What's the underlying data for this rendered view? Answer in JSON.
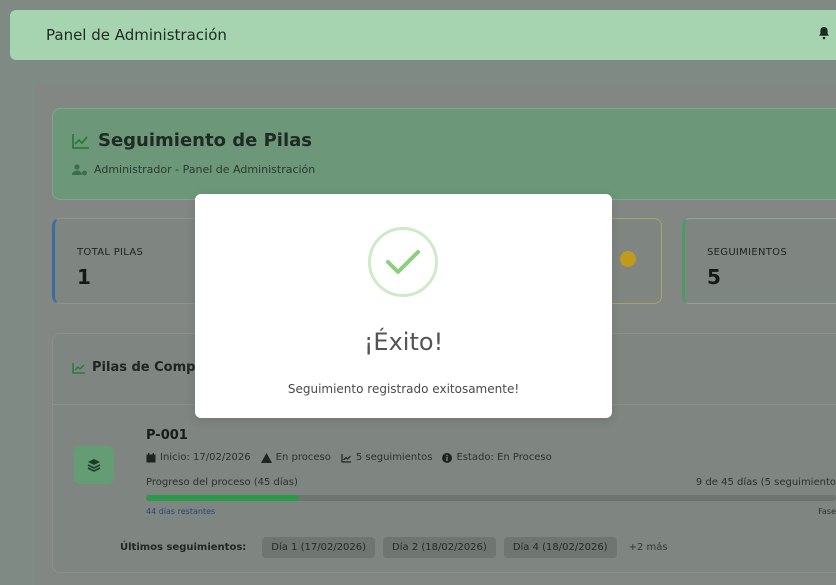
{
  "topbar": {
    "title": "Panel de Administración",
    "icon": "bell-icon"
  },
  "hero": {
    "title": "Seguimiento de Pilas",
    "subtitle": "Administrador - Panel de Administración"
  },
  "stats": [
    {
      "label": "TOTAL PILAS",
      "value": "1"
    },
    {
      "label": "SEGUIMIENTOS",
      "value": "5"
    }
  ],
  "panel": {
    "title": "Pilas de Compo"
  },
  "pile": {
    "name": "P-001",
    "start": "Inicio: 17/02/2026",
    "status_short": "En proceso",
    "tracking_count": "5 seguimientos",
    "state": "Estado: En Proceso",
    "progress_label": "Progreso del proceso (45 días)",
    "progress_right": "9 de 45 días (5 seguimiento",
    "progress_fraction": 0.2,
    "remaining": "44 días restantes",
    "phase": "Fase"
  },
  "recent": {
    "label": "Últimos seguimientos:",
    "chips": [
      "Día 1 (17/02/2026)",
      "Día 2 (18/02/2026)",
      "Día 4 (18/02/2026)"
    ],
    "more": "+2 más"
  },
  "modal": {
    "title": "¡Éxito!",
    "message": "Seguimiento registrado exitosamente!",
    "icon": "check-icon"
  },
  "colors": {
    "accent_green": "#6c9879",
    "success_check": "#8ccf7f",
    "progress": "#2b9a4b"
  }
}
